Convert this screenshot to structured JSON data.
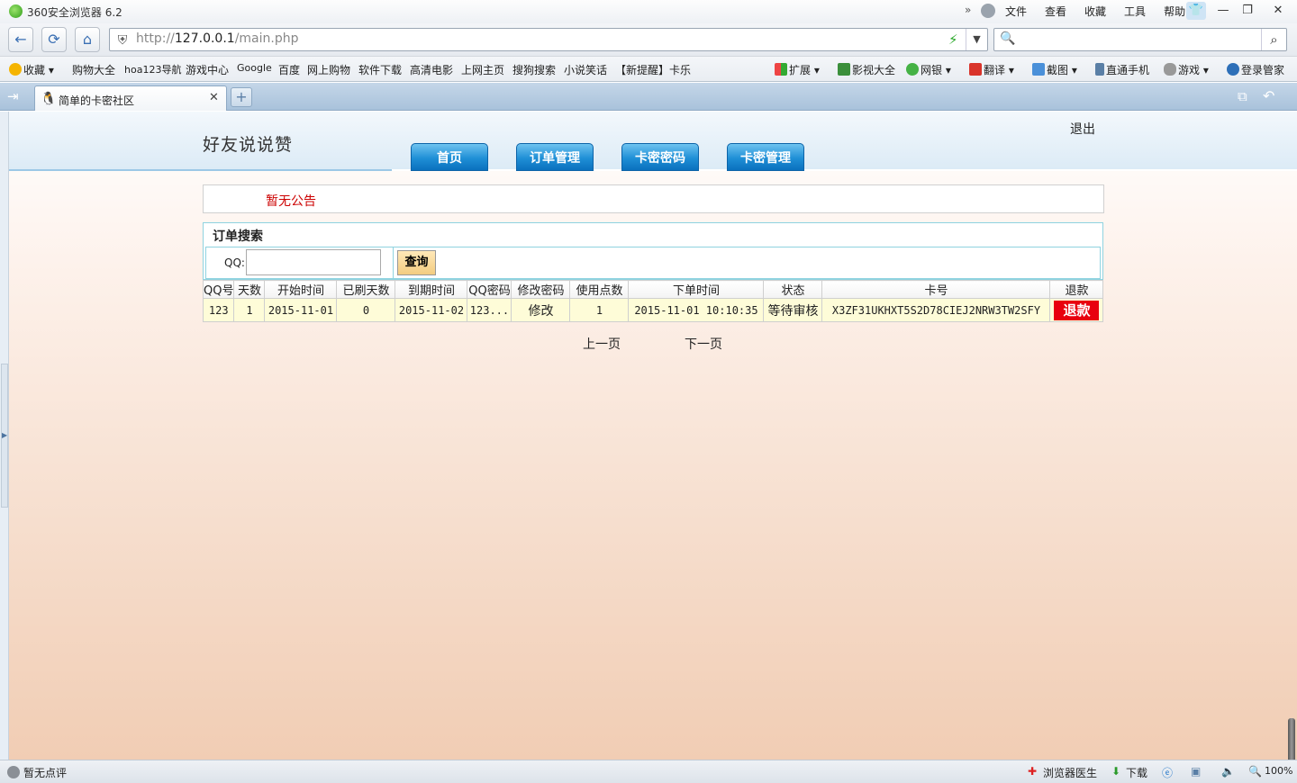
{
  "browser": {
    "title": "360安全浏览器 6.2",
    "menu": [
      "文件",
      "查看",
      "收藏",
      "工具",
      "帮助"
    ],
    "url_scheme": "http://",
    "url_host": "127.0.0.1",
    "url_path": "/main.php",
    "bookmarks": [
      "收藏",
      "购物大全",
      "hoa123导航",
      "游戏中心",
      "Google",
      "百度",
      "网上购物",
      "软件下载",
      "高清电影",
      "上网主页",
      "搜狗搜索",
      "小说笑话",
      "【新提醒】卡乐"
    ],
    "extensions": [
      "扩展",
      "影视大全",
      "网银",
      "翻译",
      "截图",
      "直通手机",
      "游戏",
      "登录管家"
    ],
    "tab_title": "简单的卡密社区",
    "status": {
      "left": "暂无点评",
      "doctor": "浏览器医生",
      "download": "下载",
      "zoom": "100%"
    }
  },
  "site": {
    "title": "好友说说赞",
    "logout": "退出",
    "nav": [
      "首页",
      "订单管理",
      "卡密密码",
      "卡密管理"
    ],
    "notice": "暂无公告"
  },
  "search": {
    "title": "订单搜索",
    "qq_label": "QQ:",
    "qq_value": "",
    "button": "查询"
  },
  "orders": {
    "columns": [
      "QQ号",
      "天数",
      "开始时间",
      "已刷天数",
      "到期时间",
      "QQ密码",
      "修改密码",
      "使用点数",
      "下单时间",
      "状态",
      "卡号",
      "退款"
    ],
    "rows": [
      {
        "qq": "123",
        "days": "1",
        "start": "2015-11-01",
        "done_days": "0",
        "expire": "2015-11-02",
        "qq_password": "123...",
        "modify": "修改",
        "points": "1",
        "order_time": "2015-11-01 10:10:35",
        "status": "等待审核",
        "card": "X3ZF31UKHXT5S2D78CIEJ2NRW3TW2SFY",
        "refund": "退款"
      }
    ]
  },
  "pager": {
    "prev": "上一页",
    "next": "下一页"
  },
  "colors": {
    "nav_tab": "#1f8fd6",
    "notice": "#cc0000",
    "refund": "#e8000f",
    "row_bg": "#fefcd8"
  }
}
